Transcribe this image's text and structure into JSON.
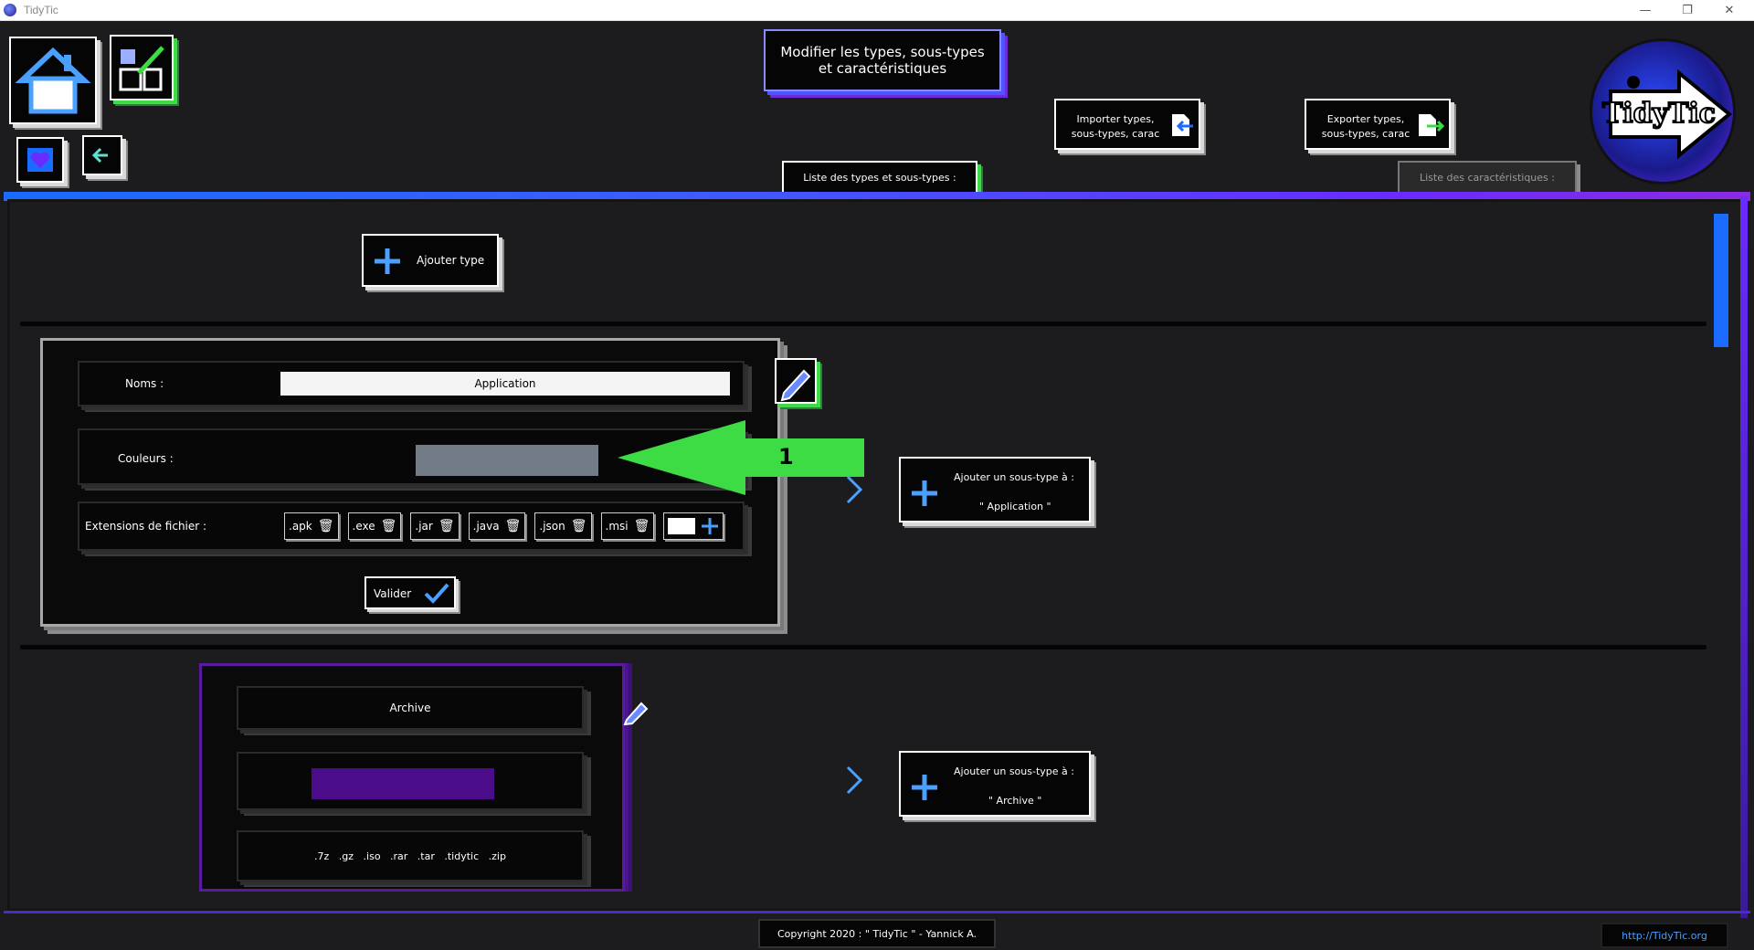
{
  "window": {
    "title": "TidyTic",
    "minimize": "—",
    "restore": "❐",
    "close": "✕"
  },
  "header": {
    "title_line1": "Modifier les types, sous-types",
    "title_line2": "et caractéristiques",
    "import_line1": "Importer types,",
    "import_line2": "sous-types, carac",
    "export_line1": "Exporter types,",
    "export_line2": "sous-types, carac",
    "tab_types": "Liste des types et sous-types :",
    "tab_carac": "Liste des caractéristiques :",
    "logo_text": "TidyTic"
  },
  "actions": {
    "add_type": "Ajouter type"
  },
  "type_form": {
    "name_label": "Noms :",
    "name_value": "Application",
    "color_label": "Couleurs :",
    "color_value": "#737b86",
    "ext_label": "Extensions de fichier :",
    "extensions": [
      ".apk",
      ".exe",
      ".jar",
      ".java",
      ".json",
      ".msi"
    ],
    "validate": "Valider",
    "annotation_number": "1",
    "add_subtype_line1": "Ajouter un sous-type à :",
    "add_subtype_line2": "\" Application \""
  },
  "type_archive": {
    "name": "Archive",
    "color_value": "#4b0c8a",
    "extensions": ".7z   .gz   .iso   .rar   .tar   .tidytic   .zip",
    "add_subtype_line1": "Ajouter un sous-type à :",
    "add_subtype_line2": "\" Archive \""
  },
  "footer": {
    "copyright": "Copyright 2020 : \" TidyTic \" - Yannick A.",
    "link": "http://TidyTic.org"
  },
  "colors": {
    "accent_blue": "#1a6bff",
    "accent_purple": "#6a2bff",
    "green": "#3ddc44"
  }
}
